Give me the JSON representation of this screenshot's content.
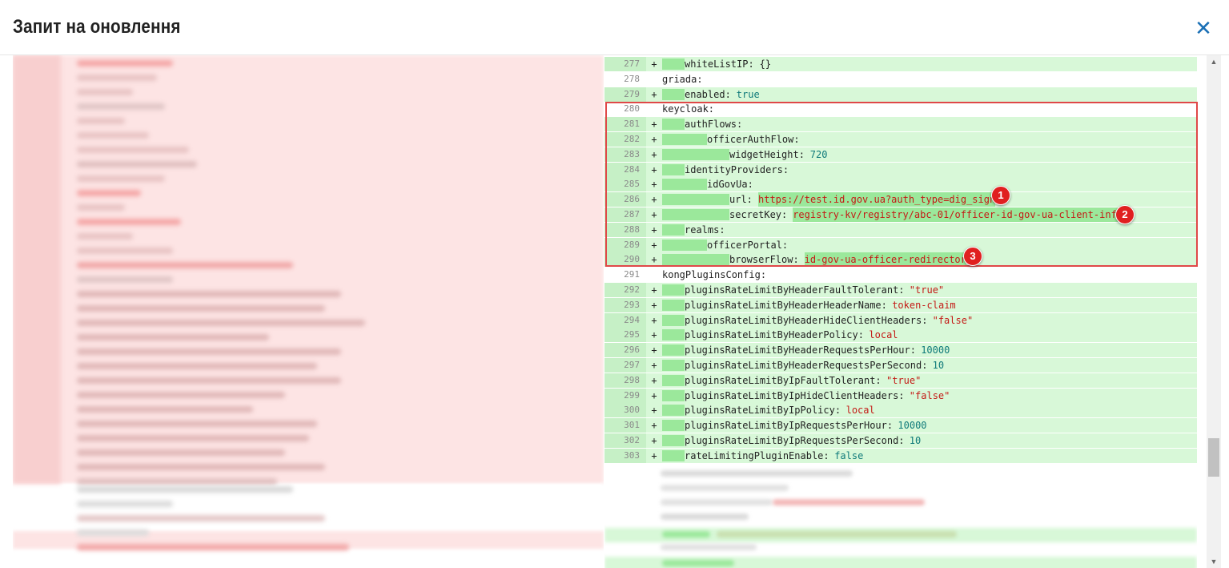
{
  "dialog": {
    "title": "Запит на оновлення",
    "close_icon": "close-icon"
  },
  "diff": {
    "rows": [
      {
        "ln": "277",
        "type": "added",
        "indent": 1,
        "key": "whiteListIP: ",
        "value": "{}",
        "vtype": "plain"
      },
      {
        "ln": "278",
        "type": "ctx",
        "indent": 0,
        "key": "griada:",
        "value": "",
        "vtype": "plain"
      },
      {
        "ln": "279",
        "type": "added",
        "indent": 1,
        "key": "enabled: ",
        "value": "true",
        "vtype": "bool"
      },
      {
        "ln": "280",
        "type": "ctx",
        "indent": 0,
        "key": "keycloak:",
        "value": "",
        "vtype": "plain"
      },
      {
        "ln": "281",
        "type": "added",
        "indent": 1,
        "key": "authFlows:",
        "value": "",
        "vtype": "plain"
      },
      {
        "ln": "282",
        "type": "added",
        "indent": 2,
        "key": "officerAuthFlow:",
        "value": "",
        "vtype": "plain"
      },
      {
        "ln": "283",
        "type": "added",
        "indent": 3,
        "key": "widgetHeight: ",
        "value": "720",
        "vtype": "num"
      },
      {
        "ln": "284",
        "type": "added",
        "indent": 1,
        "key": "identityProviders:",
        "value": "",
        "vtype": "plain"
      },
      {
        "ln": "285",
        "type": "added",
        "indent": 2,
        "key": "idGovUa:",
        "value": "",
        "vtype": "plain"
      },
      {
        "ln": "286",
        "type": "added",
        "indent": 3,
        "key": "url: ",
        "value": "https://test.id.gov.ua?auth_type=dig_sign",
        "vtype": "strhl"
      },
      {
        "ln": "287",
        "type": "added",
        "indent": 3,
        "key": "secretKey: ",
        "value": "registry-kv/registry/abc-01/officer-id-gov-ua-client-info",
        "vtype": "strhl"
      },
      {
        "ln": "288",
        "type": "added",
        "indent": 1,
        "key": "realms:",
        "value": "",
        "vtype": "plain"
      },
      {
        "ln": "289",
        "type": "added",
        "indent": 2,
        "key": "officerPortal:",
        "value": "",
        "vtype": "plain"
      },
      {
        "ln": "290",
        "type": "added",
        "indent": 3,
        "key": "browserFlow: ",
        "value": "id-gov-ua-officer-redirector",
        "vtype": "strhl"
      },
      {
        "ln": "291",
        "type": "ctx",
        "indent": 0,
        "key": "kongPluginsConfig:",
        "value": "",
        "vtype": "plain"
      },
      {
        "ln": "292",
        "type": "added",
        "indent": 1,
        "key": "pluginsRateLimitByHeaderFaultTolerant: ",
        "value": "\"true\"",
        "vtype": "str"
      },
      {
        "ln": "293",
        "type": "added",
        "indent": 1,
        "key": "pluginsRateLimitByHeaderHeaderName: ",
        "value": "token-claim",
        "vtype": "str"
      },
      {
        "ln": "294",
        "type": "added",
        "indent": 1,
        "key": "pluginsRateLimitByHeaderHideClientHeaders: ",
        "value": "\"false\"",
        "vtype": "str"
      },
      {
        "ln": "295",
        "type": "added",
        "indent": 1,
        "key": "pluginsRateLimitByHeaderPolicy: ",
        "value": "local",
        "vtype": "str"
      },
      {
        "ln": "296",
        "type": "added",
        "indent": 1,
        "key": "pluginsRateLimitByHeaderRequestsPerHour: ",
        "value": "10000",
        "vtype": "num"
      },
      {
        "ln": "297",
        "type": "added",
        "indent": 1,
        "key": "pluginsRateLimitByHeaderRequestsPerSecond: ",
        "value": "10",
        "vtype": "num"
      },
      {
        "ln": "298",
        "type": "added",
        "indent": 1,
        "key": "pluginsRateLimitByIpFaultTolerant: ",
        "value": "\"true\"",
        "vtype": "str"
      },
      {
        "ln": "299",
        "type": "added",
        "indent": 1,
        "key": "pluginsRateLimitByIpHideClientHeaders: ",
        "value": "\"false\"",
        "vtype": "str"
      },
      {
        "ln": "300",
        "type": "added",
        "indent": 1,
        "key": "pluginsRateLimitByIpPolicy: ",
        "value": "local",
        "vtype": "str"
      },
      {
        "ln": "301",
        "type": "added",
        "indent": 1,
        "key": "pluginsRateLimitByIpRequestsPerHour: ",
        "value": "10000",
        "vtype": "num"
      },
      {
        "ln": "302",
        "type": "added",
        "indent": 1,
        "key": "pluginsRateLimitByIpRequestsPerSecond: ",
        "value": "10",
        "vtype": "num"
      },
      {
        "ln": "303",
        "type": "added",
        "indent": 1,
        "key": "rateLimitingPluginEnable: ",
        "value": "false",
        "vtype": "bool"
      }
    ],
    "added_sign": "+"
  },
  "annotations": {
    "markers": [
      "1",
      "2",
      "3"
    ]
  },
  "scrollbar": {
    "up_icon": "▲",
    "down_icon": "▼"
  },
  "colors": {
    "added_bg": "#d8f8d8",
    "removed_bg": "#fde0e0",
    "annotation_red": "#e02020",
    "close_blue": "#1a6fb5"
  }
}
